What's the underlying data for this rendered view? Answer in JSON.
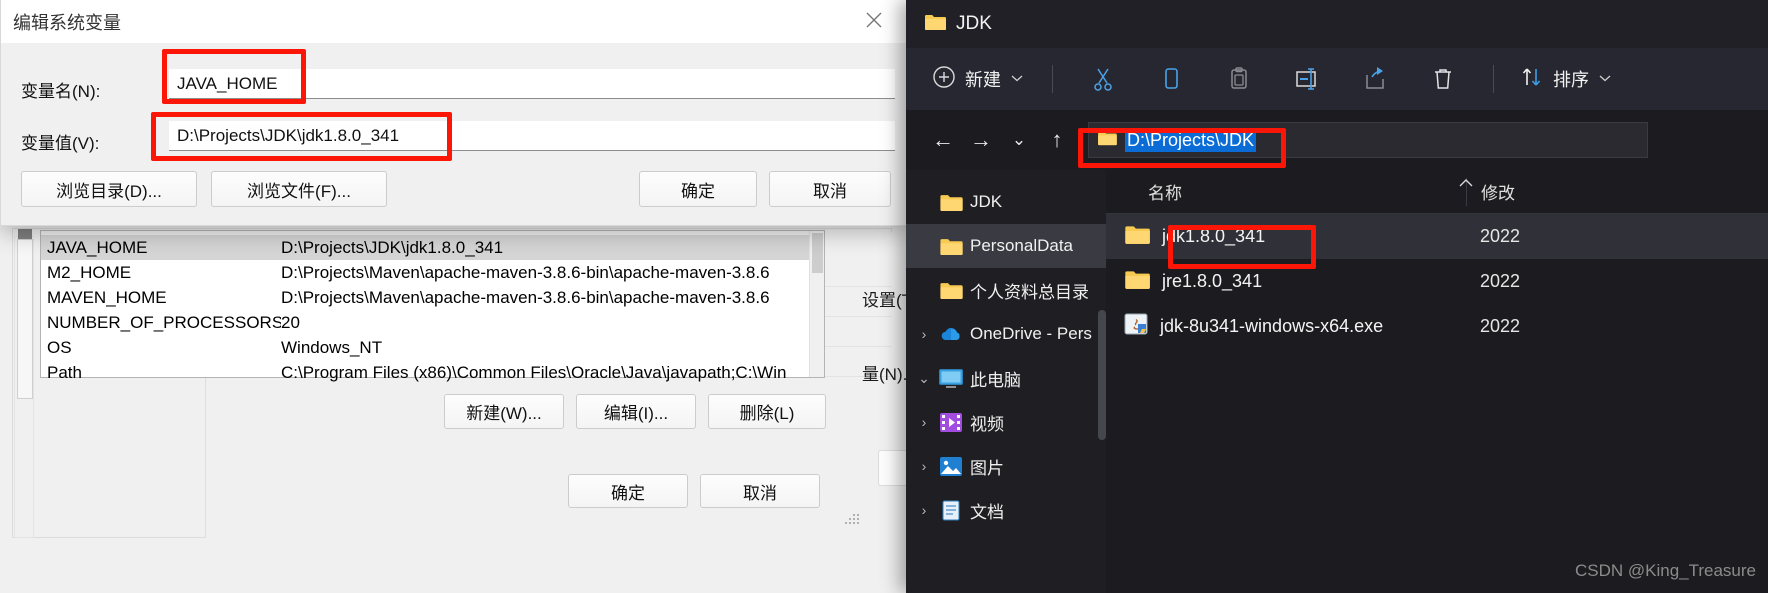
{
  "edit_dialog": {
    "title": "编辑系统变量",
    "close_icon": "close-icon",
    "fields": [
      {
        "label": "变量名(N):",
        "value": "JAVA_HOME"
      },
      {
        "label": "变量值(V):",
        "value": "D:\\Projects\\JDK\\jdk1.8.0_341"
      }
    ],
    "buttons": {
      "browse_dir": "浏览目录(D)...",
      "browse_file": "浏览文件(F)...",
      "ok": "确定",
      "cancel": "取消"
    }
  },
  "env_dialog": {
    "list": {
      "rows": [
        {
          "name": "JAVA_HOME",
          "value": "D:\\Projects\\JDK\\jdk1.8.0_341",
          "selected": true
        },
        {
          "name": "M2_HOME",
          "value": "D:\\Projects\\Maven\\apache-maven-3.8.6-bin\\apache-maven-3.8.6",
          "selected": false
        },
        {
          "name": "MAVEN_HOME",
          "value": "D:\\Projects\\Maven\\apache-maven-3.8.6-bin\\apache-maven-3.8.6",
          "selected": false
        },
        {
          "name": "NUMBER_OF_PROCESSORS",
          "value": "20",
          "selected": false
        },
        {
          "name": "OS",
          "value": "Windows_NT",
          "selected": false
        },
        {
          "name": "Path",
          "value": "C:\\Program Files (x86)\\Common Files\\Oracle\\Java\\javapath;C:\\Win",
          "selected": false
        }
      ]
    },
    "buttons": {
      "new": "新建(W)...",
      "edit": "编辑(I)...",
      "delete": "删除(L)",
      "ok": "确定",
      "cancel": "取消"
    },
    "occluded": {
      "settings": "设置(T)",
      "variables": "量(N).."
    }
  },
  "explorer": {
    "title": "JDK",
    "title_icon": "folder-icon",
    "toolbar": {
      "new_label": "新建",
      "new_icon": "plus-circle-icon",
      "new_caret": "chevron-down-icon",
      "icons": [
        {
          "name": "cut-icon"
        },
        {
          "name": "copy-icon"
        },
        {
          "name": "paste-icon"
        },
        {
          "name": "rename-icon"
        },
        {
          "name": "share-icon"
        },
        {
          "name": "delete-trash-icon"
        }
      ],
      "sort_label": "排序",
      "sort_icon": "sort-arrows-icon",
      "sort_caret": "chevron-down-icon"
    },
    "address": {
      "back_icon": "arrow-left-icon",
      "forward_icon": "arrow-right-icon",
      "recent_icon": "chevron-down-icon",
      "up_icon": "arrow-up-icon",
      "folder_icon": "folder-icon",
      "path": "D:\\Projects\\JDK"
    },
    "nav_items": [
      {
        "label": "JDK",
        "icon": "folder-icon",
        "chevron": "",
        "selected": false
      },
      {
        "label": "PersonalData",
        "icon": "folder-icon",
        "chevron": "",
        "selected": true
      },
      {
        "label": "个人资料总目录",
        "icon": "folder-icon",
        "chevron": "",
        "selected": false
      },
      {
        "label": "OneDrive - Pers",
        "icon": "onedrive-icon",
        "chevron": "›",
        "selected": false
      },
      {
        "label": "此电脑",
        "icon": "this-pc-icon",
        "chevron": "⌄",
        "selected": false
      },
      {
        "label": "视频",
        "icon": "videos-icon",
        "chevron": "›",
        "selected": false
      },
      {
        "label": "图片",
        "icon": "pictures-icon",
        "chevron": "›",
        "selected": false
      },
      {
        "label": "文档",
        "icon": "documents-icon",
        "chevron": "›",
        "selected": false
      }
    ],
    "columns": {
      "name": "名称",
      "modified": "修改"
    },
    "sort_mark_icon": "caret-up-icon",
    "files": [
      {
        "name": "jdk1.8.0_341",
        "icon": "folder-icon",
        "modified": "2022",
        "selected": true
      },
      {
        "name": "jre1.8.0_341",
        "icon": "folder-icon",
        "modified": "2022",
        "selected": false
      },
      {
        "name": "jdk-8u341-windows-x64.exe",
        "icon": "java-exe-icon",
        "modified": "2022",
        "selected": false
      }
    ],
    "watermark": "CSDN @King_Treasure"
  },
  "annotations": {
    "highlight_color": "#fc1608"
  }
}
